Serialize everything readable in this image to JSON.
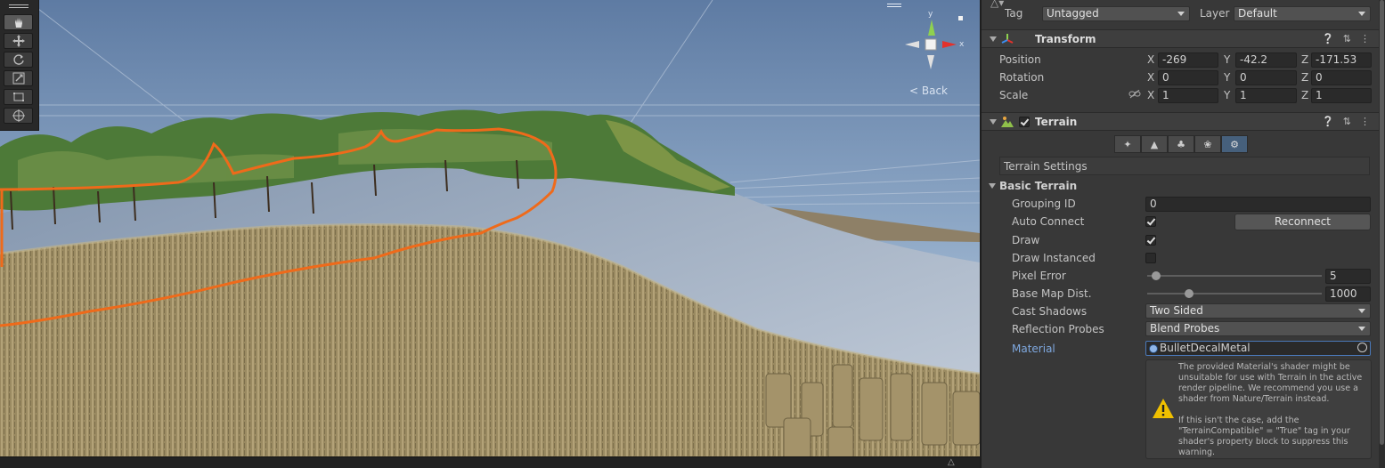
{
  "scene": {
    "back_label": "< Back",
    "gizmo_y": "y",
    "gizmo_x": "x",
    "tools": [
      "hand-icon",
      "move-icon",
      "rotate-icon",
      "scale-icon",
      "rect-icon",
      "transform-icon"
    ]
  },
  "header": {
    "tag_label": "Tag",
    "tag_value": "Untagged",
    "layer_label": "Layer",
    "layer_value": "Default"
  },
  "transform": {
    "title": "Transform",
    "position_label": "Position",
    "rotation_label": "Rotation",
    "scale_label": "Scale",
    "x": "X",
    "y": "Y",
    "z": "Z",
    "position": {
      "x": "-269",
      "y": "-42.2",
      "z": "-171.53"
    },
    "rotation": {
      "x": "0",
      "y": "0",
      "z": "0"
    },
    "scale": {
      "x": "1",
      "y": "1",
      "z": "1"
    }
  },
  "terrain": {
    "title": "Terrain",
    "settings_label": "Terrain Settings",
    "basic_terrain": "Basic Terrain",
    "grouping_id_label": "Grouping ID",
    "grouping_id_value": "0",
    "auto_connect_label": "Auto Connect",
    "reconnect_label": "Reconnect",
    "draw_label": "Draw",
    "draw_instanced_label": "Draw Instanced",
    "pixel_error_label": "Pixel Error",
    "pixel_error_value": "5",
    "pixel_error_fraction": 0.05,
    "base_map_label": "Base Map Dist.",
    "base_map_value": "1000",
    "base_map_fraction": 0.24,
    "cast_shadows_label": "Cast Shadows",
    "cast_shadows_value": "Two Sided",
    "reflection_probes_label": "Reflection Probes",
    "reflection_probes_value": "Blend Probes",
    "material_label": "Material",
    "material_value": "BulletDecalMetal",
    "warning": "The provided Material's shader might be unsuitable for use with Terrain in the active render pipeline. We recommend you use a shader from Nature/Terrain instead.\n\nIf this isn't the case, add the \"TerrainCompatible\" = \"True\" tag in your shader's property block to suppress this warning."
  },
  "colors": {
    "accent": "#7fa9e0",
    "selected_tool": "#46607c",
    "orange_line": "#ef6a1a",
    "warning": "#f0c000"
  }
}
